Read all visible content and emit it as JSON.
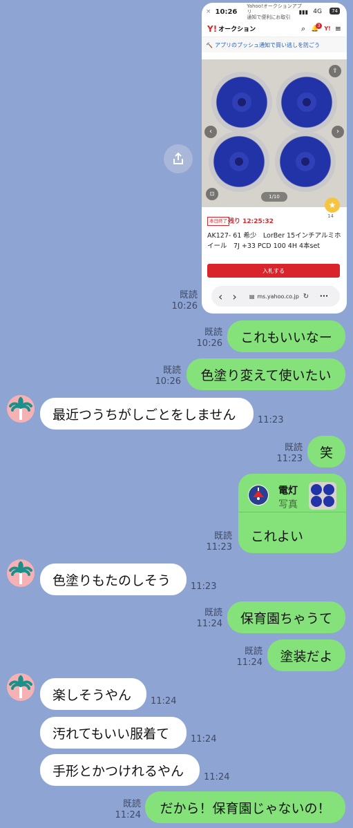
{
  "shared_screenshot": {
    "status_time": "10:26",
    "notif_line1": "Yahoo!オークションアプリ",
    "notif_line2": "通知で便利にお取引",
    "notif_close": "×",
    "signal": "4G",
    "battery": "74",
    "logo_y": "Y!",
    "logo_text": "オークション",
    "bell_badge": "3",
    "promo_text": "アプリのプッシュ通知で買い逃しを防ごう",
    "photo_counter": "1/10",
    "watch_count": "14",
    "ends_today_badge": "本日終了",
    "time_remaining": "残り 12:25:32",
    "title": "AK127- 61 希少　LorBer 15インチアルミホイール　7J +33 PCD 100 4H 4本set",
    "bid_button": "入札する",
    "url": "ms.yahoo.co.jp",
    "nav_back": "‹",
    "nav_forward": "›",
    "more": "•••"
  },
  "messages": [
    {
      "id": "m0",
      "read": "既読",
      "time": "10:26"
    },
    {
      "id": "m1",
      "text": "これもいいなー",
      "read": "既読",
      "time": "10:26"
    },
    {
      "id": "m2",
      "text": "色塗り変えて使いたい",
      "read": "既読",
      "time": "10:26"
    },
    {
      "id": "m3",
      "text": "最近つうちがしごとをしません",
      "time": "11:23"
    },
    {
      "id": "m4",
      "text": "笑",
      "read": "既読",
      "time": "11:23"
    },
    {
      "id": "m5",
      "reply_name": "電灯",
      "reply_kind": "写真",
      "text": "これよい",
      "read": "既読",
      "time": "11:23"
    },
    {
      "id": "m6",
      "text": "色塗りもたのしそう",
      "time": "11:23"
    },
    {
      "id": "m7",
      "text": "保育園ちゃうて",
      "read": "既読",
      "time": "11:24"
    },
    {
      "id": "m8",
      "text": "塗装だよ",
      "read": "既読",
      "time": "11:24"
    },
    {
      "id": "m9",
      "text": "楽しそうやん",
      "time": "11:24"
    },
    {
      "id": "m10",
      "text": "汚れてもいい服着て",
      "time": "11:24"
    },
    {
      "id": "m11",
      "text": "手形とかつけれるやん",
      "time": "11:24"
    },
    {
      "id": "m12",
      "text": "だから！保育園じゃないの！",
      "read": "既読",
      "time": "11:24"
    }
  ],
  "colors": {
    "background": "#8ea4d2",
    "my_bubble": "#85e27a",
    "their_bubble": "#ffffff",
    "avatar": "#f6b1b4"
  }
}
